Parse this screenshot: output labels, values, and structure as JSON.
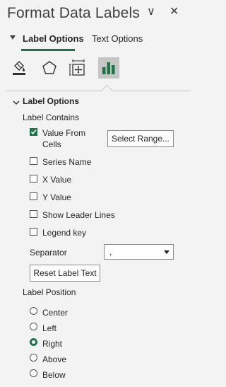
{
  "pane": {
    "title": "Format Data Labels",
    "dropdown_glyph": "∨",
    "close_glyph": "✕"
  },
  "tabs": [
    {
      "label": "Label Options",
      "selected": true
    },
    {
      "label": "Text Options",
      "selected": false
    }
  ],
  "category_icons": [
    {
      "name": "fill-line-icon",
      "selected": false
    },
    {
      "name": "effects-icon",
      "selected": false
    },
    {
      "name": "size-properties-icon",
      "selected": false
    },
    {
      "name": "label-options-icon",
      "selected": true
    }
  ],
  "section": {
    "title": "Label Options",
    "label_contains": "Label Contains",
    "checkboxes": [
      {
        "label_line1": "Value From",
        "label_line2": "Cells",
        "checked": true
      },
      {
        "label": "Series Name",
        "checked": false
      },
      {
        "label": "X Value",
        "checked": false
      },
      {
        "label": "Y Value",
        "checked": false
      },
      {
        "label": "Show Leader Lines",
        "checked": false
      },
      {
        "label": "Legend key",
        "checked": false
      }
    ],
    "select_range_button": "Select Range...",
    "separator_label": "Separator",
    "separator_value": ",",
    "reset_button": "Reset Label Text",
    "label_position_title": "Label Position",
    "positions": [
      {
        "label": "Center",
        "checked": false
      },
      {
        "label": "Left",
        "checked": false
      },
      {
        "label": "Right",
        "checked": true
      },
      {
        "label": "Above",
        "checked": false
      },
      {
        "label": "Below",
        "checked": false
      }
    ]
  },
  "colors": {
    "accent": "#217346",
    "background": "#f3f3f3"
  }
}
